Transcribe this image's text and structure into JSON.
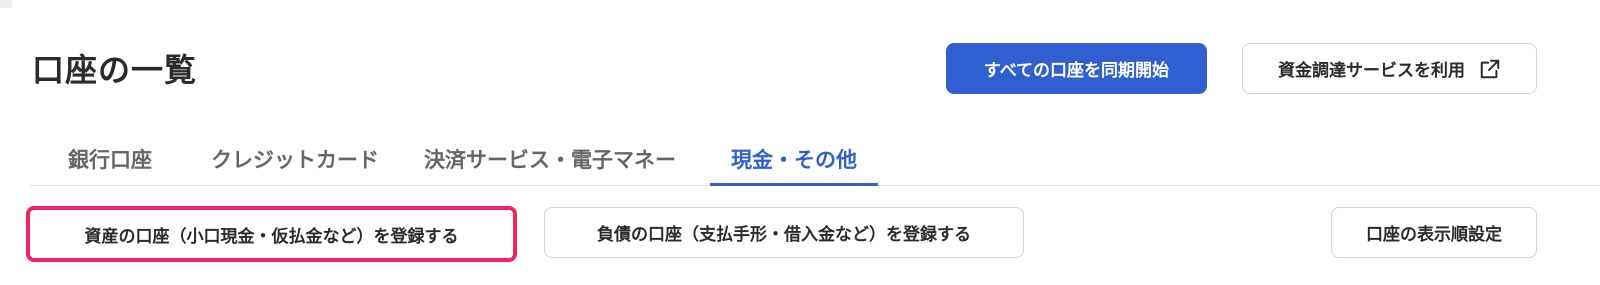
{
  "page": {
    "title": "口座の一覧"
  },
  "header": {
    "sync_all_label": "すべての口座を同期開始",
    "funding_label": "資金調達サービスを利用",
    "funding_icon": "external-link-icon"
  },
  "tabs": [
    {
      "label": "銀行口座",
      "active": false
    },
    {
      "label": "クレジットカード",
      "active": false
    },
    {
      "label": "決済サービス・電子マネー",
      "active": false
    },
    {
      "label": "現金・その他",
      "active": true
    }
  ],
  "actions": {
    "register_asset_label": "資産の口座（小口現金・仮払金など）を登録する",
    "register_liability_label": "負債の口座（支払手形・借入金など）を登録する",
    "display_order_label": "口座の表示順設定"
  },
  "colors": {
    "accent": "#2f5fd0",
    "highlight": "#f0245e",
    "text": "#2b2b2b",
    "muted": "#666666",
    "border": "#d4d4d4"
  }
}
